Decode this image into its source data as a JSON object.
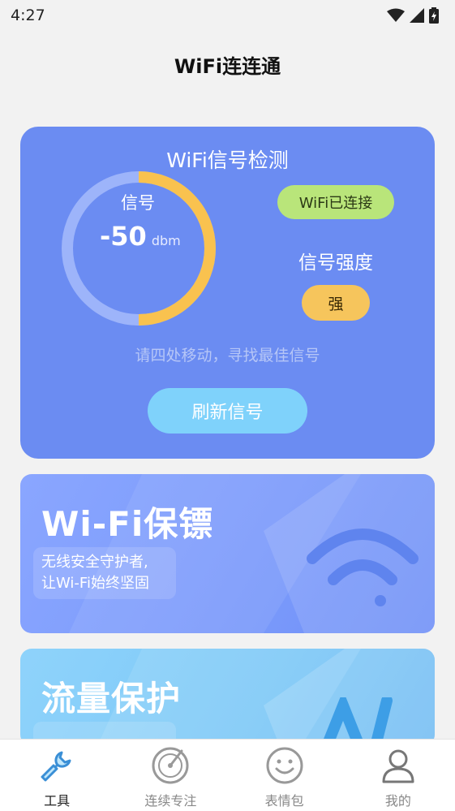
{
  "status_bar": {
    "time": "4:27",
    "icons": [
      "wifi-icon",
      "cellular-signal-icon",
      "battery-charging-icon"
    ]
  },
  "app": {
    "title": "WiFi连连通"
  },
  "signal_card": {
    "title": "WiFi信号检测",
    "gauge_label": "信号",
    "signal_value": "-50",
    "signal_unit": "dbm",
    "gauge_fill_fraction": 0.5,
    "connection_status": "WiFi已连接",
    "strength_title": "信号强度",
    "strength_value": "强",
    "hint": "请四处移动，寻找最佳信号",
    "refresh_button": "刷新信号",
    "colors": {
      "card": "#6b8cf2",
      "gauge_fill": "#f9c24f",
      "gauge_track": "#9db4fa",
      "badge_green": "#b9e57a",
      "badge_yellow": "#f6c55c",
      "button": "#7fd2fb"
    }
  },
  "feature_cards": {
    "bodyguard": {
      "title": "Wi-Fi保镖",
      "desc_line1": "无线安全守护者,",
      "desc_line2": "让Wi-Fi始终坚固",
      "icon": "wifi-icon"
    },
    "flow": {
      "title": "流量保护",
      "desc_line1": "",
      "icon": "chart-icon"
    }
  },
  "tab_bar": {
    "tabs": [
      {
        "label": "工具",
        "icon": "wrench-icon",
        "active": true
      },
      {
        "label": "连续专注",
        "icon": "focus-dial-icon",
        "active": false
      },
      {
        "label": "表情包",
        "icon": "smiley-icon",
        "active": false
      },
      {
        "label": "我的",
        "icon": "user-icon",
        "active": false
      }
    ]
  }
}
